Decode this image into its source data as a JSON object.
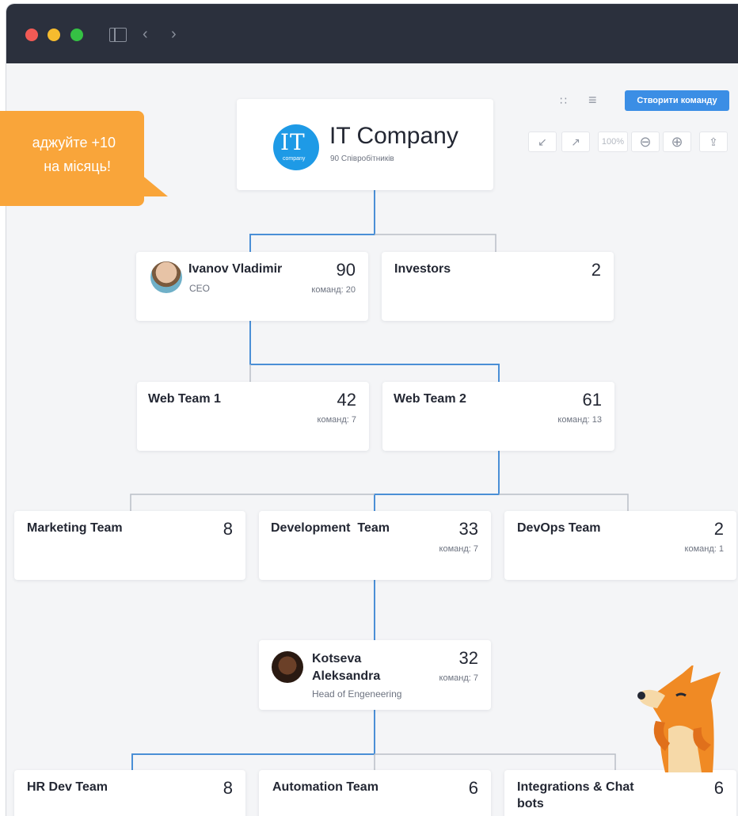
{
  "promo": {
    "line1": "аджуйте +10",
    "line2": "на місяць!"
  },
  "toolbar": {
    "create_team_label": "Створити команду",
    "zoom_level": "100%",
    "icons": [
      "org-tree-icon",
      "list-view-icon",
      "collapse-icon",
      "expand-icon",
      "zoom-out-icon",
      "zoom-in-icon",
      "export-icon"
    ]
  },
  "root": {
    "logo_text": "IT",
    "logo_caption": "company",
    "title": "IT Company",
    "subtitle": "90 Співробітників"
  },
  "nodes": {
    "ceo": {
      "name": "Ivanov Vladimir",
      "role": "CEO",
      "count": "90",
      "sub": "команд: 20"
    },
    "investors": {
      "name": "Investors",
      "count": "2"
    },
    "web1": {
      "name": "Web Team 1",
      "count": "42",
      "sub": "команд: 7"
    },
    "web2": {
      "name": "Web Team 2",
      "count": "61",
      "sub": "команд: 13"
    },
    "marketing": {
      "name": "Marketing Team",
      "count": "8"
    },
    "development": {
      "name": "Development  Team",
      "count": "33",
      "sub": "команд: 7"
    },
    "devops": {
      "name": "DevOps Team",
      "count": "2",
      "sub": "команд: 1"
    },
    "head_eng": {
      "name_line1": "Kotseva",
      "name_line2": "Aleksandra",
      "role": "Head of Engeneering",
      "count": "32",
      "sub": "команд: 7"
    },
    "hr": {
      "name": "HR Dev Team",
      "count": "8"
    },
    "automation": {
      "name": "Automation Team",
      "count": "6"
    },
    "integrations": {
      "name_line1": "Integrations & Chat",
      "name_line2": "bots",
      "count": "6"
    }
  },
  "colors": {
    "accent": "#3b8ee5",
    "titlebar": "#2b303d",
    "promo": "#f9a53a",
    "active_line": "#4a8fd6",
    "inactive_line": "#b9bec7"
  }
}
